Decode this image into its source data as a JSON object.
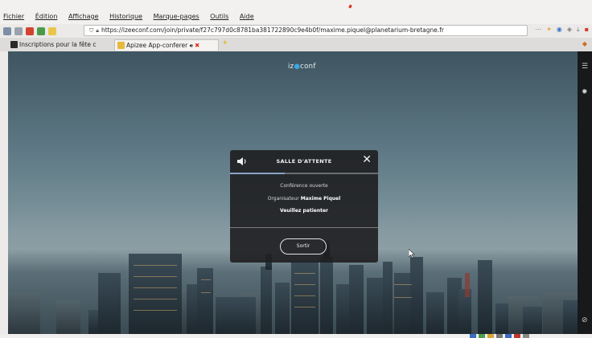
{
  "menubar": {
    "items": [
      "Fichier",
      "Édition",
      "Affichage",
      "Historique",
      "Marque-pages",
      "Outils",
      "Aide"
    ]
  },
  "browser": {
    "url": "https://izeeconf.com/join/private/f27c797d0c8781ba381722890c9e4b0f/maxime.piquel@planetarium-bretagne.fr",
    "tabs": [
      {
        "label": "Inscriptions pour la fête c"
      },
      {
        "label": "Apizee App-conferer"
      }
    ]
  },
  "app": {
    "logo": {
      "prefix": "iz",
      "dot": "●",
      "suffix": "conf"
    }
  },
  "dialog": {
    "title": "SALLE D'ATTENTE",
    "line1": "Conférence ouverte",
    "organizer_label": "Organisateur",
    "organizer_name": "Maxime Piquel",
    "line3": "Veuillez patienter",
    "button": "Sortir",
    "progress": 0.37,
    "close": "✕"
  },
  "colors": {
    "progress": "#8ba3c7",
    "dialog_bg": "#1e1e20",
    "sidebar_bg": "#17191b",
    "tab_close": "#e0321d"
  }
}
